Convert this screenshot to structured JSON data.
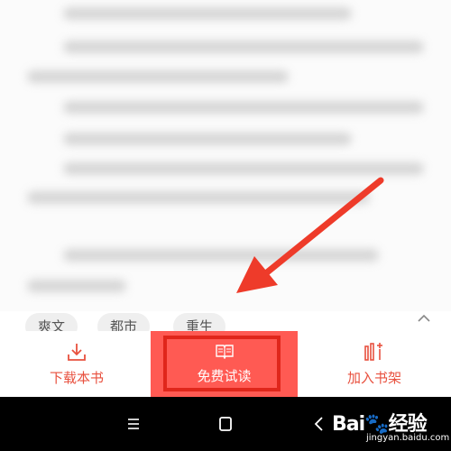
{
  "tags": [
    "爽文",
    "都市",
    "重生"
  ],
  "actions": {
    "download_label": "下载本书",
    "free_read_label": "免费试读",
    "add_shelf_label": "加入书架"
  },
  "icons": {
    "download": "download-icon",
    "book": "open-book-icon",
    "shelf": "add-bookshelf-icon",
    "chevron": "chevron-up-icon"
  },
  "colors": {
    "accent": "#e8503e",
    "free_read_bg": "#ff5a53",
    "highlight": "#e0261b"
  },
  "watermark": {
    "brand": "Bai",
    "brand_suffix": "经验",
    "url": "jingyan.baidu.com"
  }
}
